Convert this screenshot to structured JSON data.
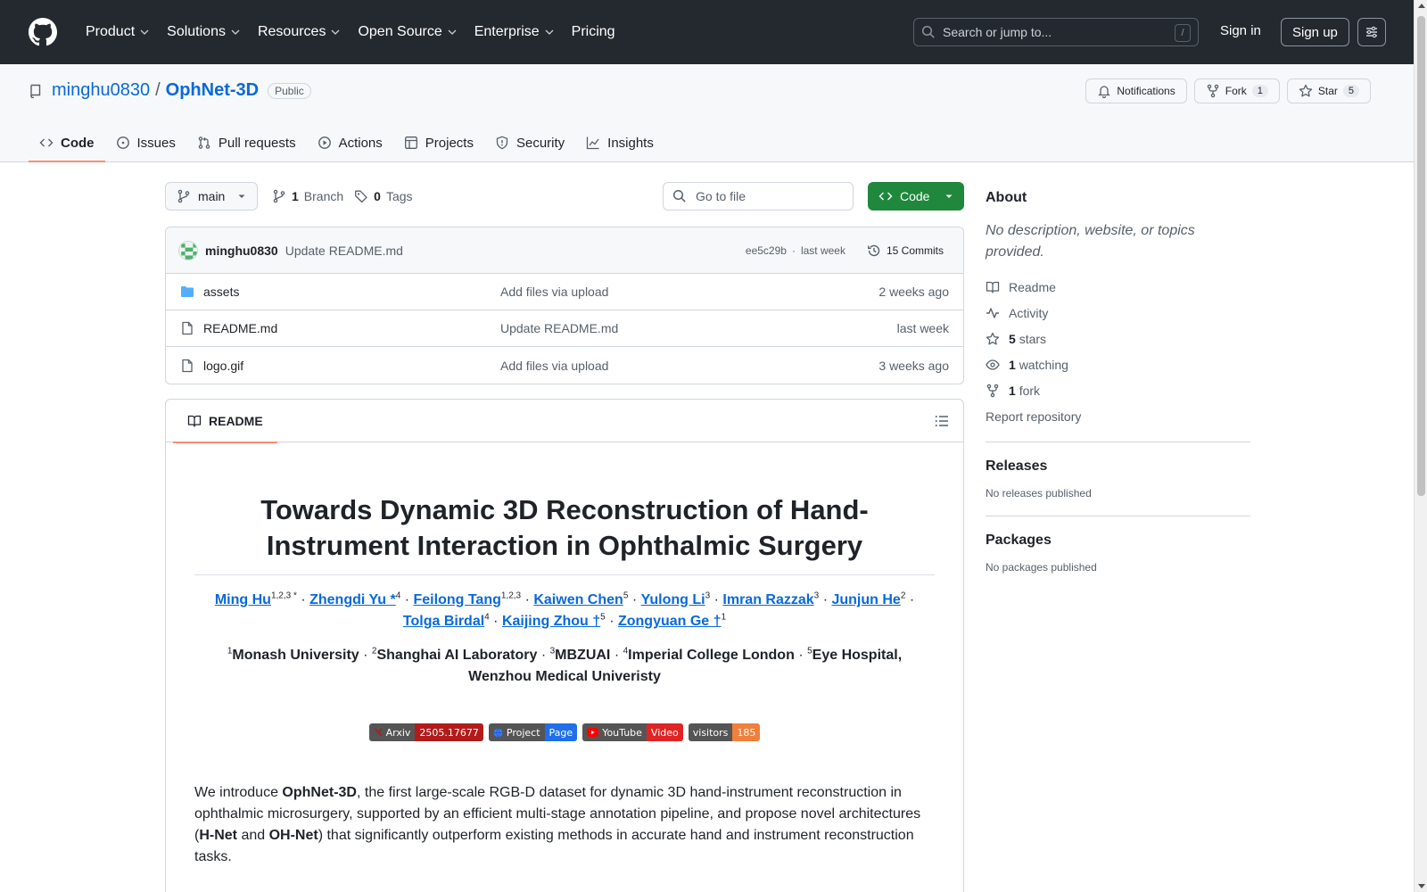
{
  "header": {
    "nav": [
      {
        "label": "Product",
        "dropdown": true
      },
      {
        "label": "Solutions",
        "dropdown": true
      },
      {
        "label": "Resources",
        "dropdown": true
      },
      {
        "label": "Open Source",
        "dropdown": true
      },
      {
        "label": "Enterprise",
        "dropdown": true
      },
      {
        "label": "Pricing",
        "dropdown": false
      }
    ],
    "search_placeholder": "Search or jump to...",
    "search_shortcut": "/",
    "sign_in": "Sign in",
    "sign_up": "Sign up"
  },
  "repo": {
    "owner": "minghu0830",
    "separator": "/",
    "name": "OphNet-3D",
    "visibility": "Public",
    "notifications_label": "Notifications",
    "fork_label": "Fork",
    "fork_count": "1",
    "star_label": "Star",
    "star_count": "5",
    "tabs": [
      {
        "label": "Code",
        "icon": "code-icon",
        "active": true
      },
      {
        "label": "Issues",
        "icon": "issue-icon",
        "active": false
      },
      {
        "label": "Pull requests",
        "icon": "pull-request-icon",
        "active": false
      },
      {
        "label": "Actions",
        "icon": "play-icon",
        "active": false
      },
      {
        "label": "Projects",
        "icon": "table-icon",
        "active": false
      },
      {
        "label": "Security",
        "icon": "shield-icon",
        "active": false
      },
      {
        "label": "Insights",
        "icon": "graph-icon",
        "active": false
      }
    ]
  },
  "toolbar": {
    "branch": "main",
    "branch_count": "1",
    "branch_label": "Branch",
    "tag_count": "0",
    "tag_label": "Tags",
    "goto_placeholder": "Go to file",
    "code_label": "Code"
  },
  "commit": {
    "author": "minghu0830",
    "message": "Update README.md",
    "hash": "ee5c29b",
    "dot": "·",
    "time": "last week",
    "commits_label": "15 Commits"
  },
  "files": [
    {
      "name": "assets",
      "type": "folder",
      "message": "Add files via upload",
      "date": "2 weeks ago"
    },
    {
      "name": "README.md",
      "type": "file",
      "message": "Update README.md",
      "date": "last week"
    },
    {
      "name": "logo.gif",
      "type": "file",
      "message": "Add files via upload",
      "date": "3 weeks ago"
    }
  ],
  "readme": {
    "tab_label": "README",
    "title": "Towards Dynamic 3D Reconstruction of Hand-Instrument Interaction in Ophthalmic Surgery",
    "authors": [
      {
        "name": "Ming Hu",
        "sup": "1,2,3 *"
      },
      {
        "name": "Zhengdi Yu *",
        "sup": "4"
      },
      {
        "name": "Feilong Tang",
        "sup": "1,2,3"
      },
      {
        "name": "Kaiwen Chen",
        "sup": "5"
      },
      {
        "name": "Yulong Li",
        "sup": "3"
      },
      {
        "name": "Imran Razzak",
        "sup": "3"
      },
      {
        "name": "Junjun He",
        "sup": "2"
      },
      {
        "name": "Tolga Birdal",
        "sup": "4"
      },
      {
        "name": "Kaijing Zhou †",
        "sup": "5"
      },
      {
        "name": "Zongyuan Ge †",
        "sup": "1"
      }
    ],
    "author_sep": "·",
    "affiliations": [
      {
        "sup": "1",
        "name": "Monash University"
      },
      {
        "sup": "2",
        "name": "Shanghai AI Laboratory"
      },
      {
        "sup": "3",
        "name": "MBZUAI"
      },
      {
        "sup": "4",
        "name": "Imperial College London"
      },
      {
        "sup": "5",
        "name": "Eye Hospital, Wenzhou Medical Univeristy"
      }
    ],
    "badges": [
      {
        "left": "Arxiv",
        "right": "2505.17677",
        "color": "#b31b1b",
        "icon": "arxiv-icon"
      },
      {
        "left": "Project",
        "right": "Page",
        "color": "#1f6feb",
        "icon": "globe-icon"
      },
      {
        "left": "YouTube",
        "right": "Video",
        "color": "#e02424",
        "icon": "youtube-icon"
      },
      {
        "left": "visitors",
        "right": "185",
        "color": "#f0803c",
        "icon": ""
      }
    ],
    "intro": {
      "p1": "We introduce ",
      "b1": "OphNet-3D",
      "p2": ", the first large-scale RGB-D dataset for dynamic 3D hand-instrument reconstruction in ophthalmic microsurgery, supported by an efficient multi-stage annotation pipeline, and propose novel architectures (",
      "b2": "H-Net",
      "p3": " and ",
      "b3": "OH-Net",
      "p4": ") that significantly outperform existing methods in accurate hand and instrument reconstruction tasks."
    }
  },
  "about": {
    "heading": "About",
    "description": "No description, website, or topics provided.",
    "readme": "Readme",
    "activity": "Activity",
    "stars_count": "5",
    "stars_label": "stars",
    "watching_count": "1",
    "watching_label": "watching",
    "fork_count": "1",
    "fork_label": "fork",
    "report": "Report repository"
  },
  "releases": {
    "heading": "Releases",
    "empty": "No releases published"
  },
  "packages": {
    "heading": "Packages",
    "empty": "No packages published"
  },
  "colors": {
    "accent": "#0969da",
    "header_bg": "#24292f",
    "code_btn": "#1f883d",
    "tab_underline": "#fd8c73"
  }
}
